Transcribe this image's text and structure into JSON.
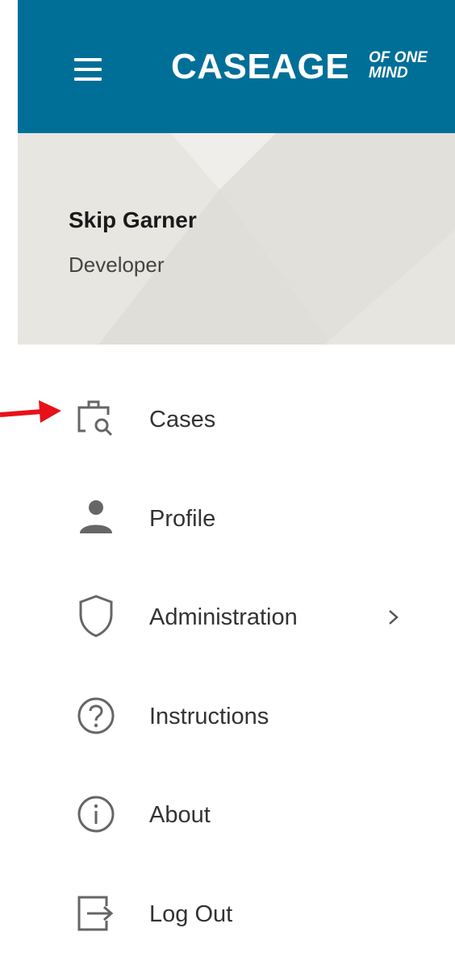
{
  "header": {
    "brand": "CASEAGE",
    "tagline_line1": "OF ONE",
    "tagline_line2": "MIND",
    "bg_color": "#006f98"
  },
  "user": {
    "name": "Skip Garner",
    "role": "Developer"
  },
  "nav": {
    "items": [
      {
        "label": "Cases",
        "icon": "case-search-icon"
      },
      {
        "label": "Profile",
        "icon": "person-icon"
      },
      {
        "label": "Administration",
        "icon": "shield-icon",
        "has_submenu": true
      },
      {
        "label": "Instructions",
        "icon": "question-circle-icon"
      },
      {
        "label": "About",
        "icon": "info-circle-icon"
      },
      {
        "label": "Log Out",
        "icon": "logout-icon"
      }
    ]
  },
  "annotation": {
    "color": "#e8101a",
    "points_to": "Cases"
  }
}
